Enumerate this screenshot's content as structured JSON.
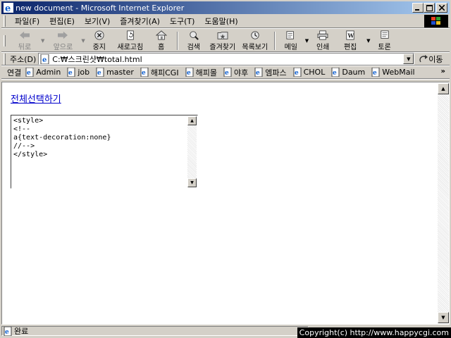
{
  "window": {
    "title": "new document - Microsoft Internet Explorer"
  },
  "menu": {
    "items": [
      "파일(F)",
      "편집(E)",
      "보기(V)",
      "즐겨찾기(A)",
      "도구(T)",
      "도움말(H)"
    ]
  },
  "toolbar": {
    "back_label": "뒤로",
    "forward_label": "앞으로",
    "stop_label": "중지",
    "refresh_label": "새로고침",
    "home_label": "홈",
    "search_label": "검색",
    "favorites_label": "즐겨찾기",
    "history_label": "목록보기",
    "mail_label": "메일",
    "print_label": "인쇄",
    "edit_label": "편집",
    "discuss_label": "토론"
  },
  "address": {
    "label": "주소(D)",
    "value": "C:₩스크린샷₩total.html",
    "go_label": "이동"
  },
  "links": {
    "label": "연결",
    "items": [
      "Admin",
      "job",
      "master",
      "해피CGI",
      "해피몰",
      "야후",
      "엠파스",
      "CHOL",
      "Daum",
      "WebMail"
    ]
  },
  "page": {
    "select_all_link": "전체선택하기",
    "textarea_value": "<style>\n<!--\na{text-decoration:none}\n//-->\n</style>"
  },
  "status": {
    "text": "완료",
    "copyright": "Copyright(c) http://www.happycgi.com"
  }
}
